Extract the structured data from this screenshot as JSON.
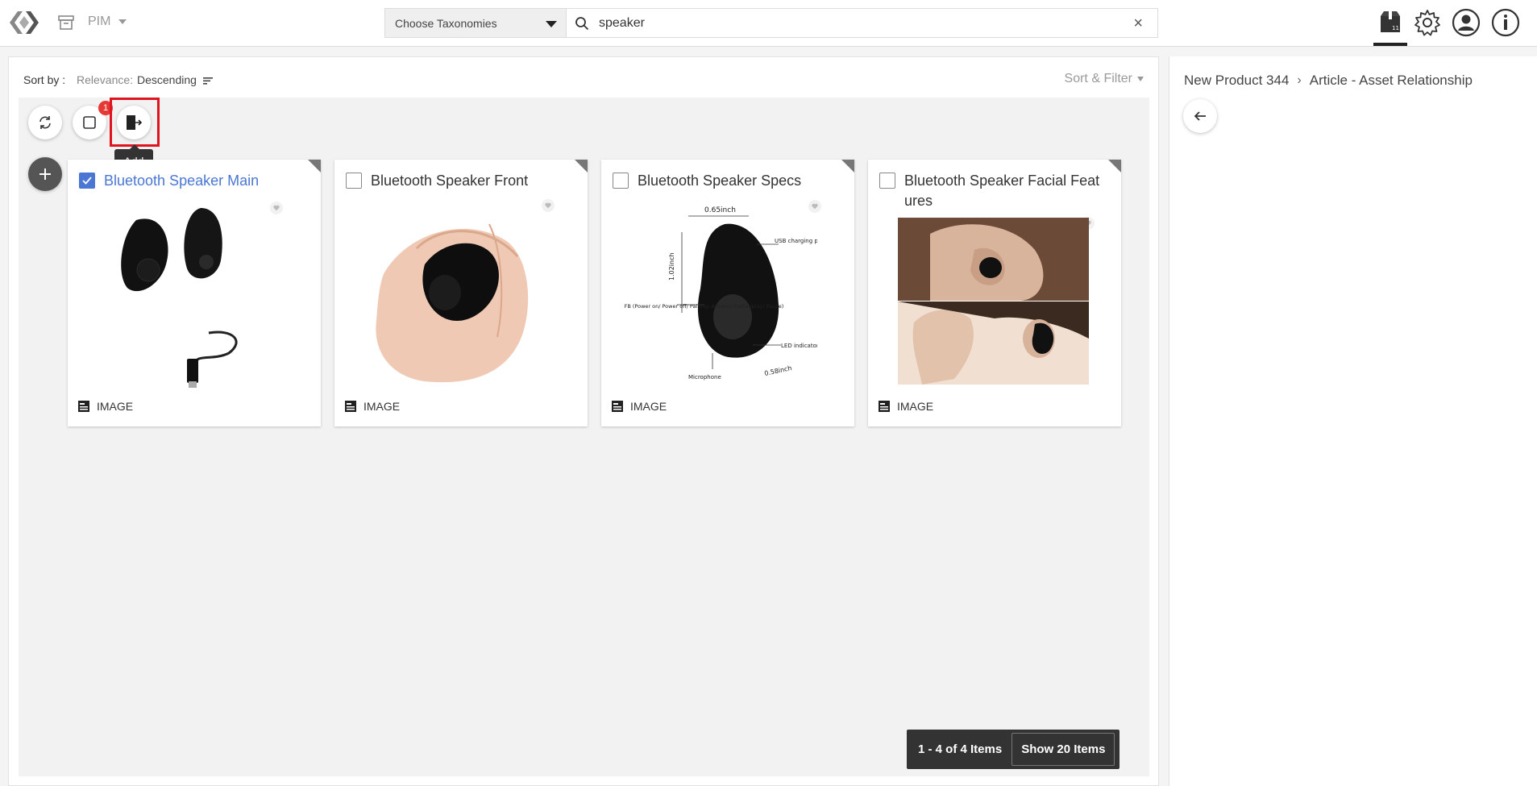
{
  "header": {
    "module_label": "PIM",
    "taxonomy_placeholder": "Choose Taxonomies",
    "search_value": "speaker",
    "clear_symbol": "×",
    "icons": [
      "logo-icon",
      "archive-icon",
      "module-caret-icon",
      "taxonomy-caret-icon",
      "search-icon",
      "clear-icon",
      "asset-box-icon",
      "settings-gear-icon",
      "user-avatar-icon",
      "info-icon"
    ]
  },
  "sort": {
    "label": "Sort by :",
    "key": "Relevance:",
    "value": "Descending",
    "filter_label": "Sort & Filter"
  },
  "toolbar": {
    "badge_count": "1",
    "add_tooltip": "Add"
  },
  "cards": [
    {
      "title": "Bluetooth Speaker Main",
      "type": "IMAGE",
      "checked": true
    },
    {
      "title": "Bluetooth Speaker Front",
      "type": "IMAGE",
      "checked": false
    },
    {
      "title": "Bluetooth Speaker Specs",
      "type": "IMAGE",
      "checked": false
    },
    {
      "title": "Bluetooth Speaker Facial Feat ures",
      "type": "IMAGE",
      "checked": false
    }
  ],
  "specs_labels": {
    "width": "0.65inch",
    "height": "1.02inch",
    "depth": "0.58inch",
    "usb": "USB charging port",
    "led": "LED indicator",
    "mfb": "MFB (Power on/ Power off/ Pairing/ Answer/ Redial/play/ Pause)",
    "mic": "Microphone"
  },
  "pager": {
    "count": "1 - 4 of 4 Items",
    "show": "Show 20 Items"
  },
  "right_panel": {
    "crumb_1": "New Product 344",
    "crumb_sep": "›",
    "crumb_2": "Article - Asset Relationship"
  },
  "colors": {
    "accent": "#4a77d4",
    "badge": "#e53935",
    "highlight": "#e0141e",
    "dark": "#333333"
  }
}
